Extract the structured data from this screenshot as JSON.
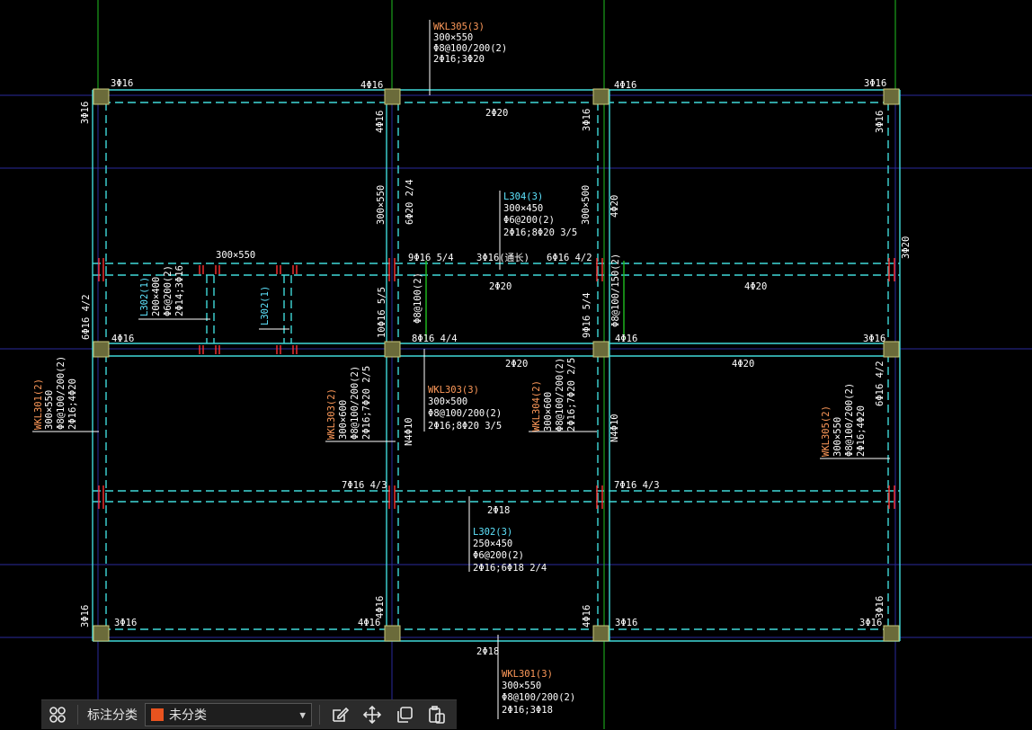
{
  "colors": {
    "background": "#000000",
    "grid_blue": "#2a2a9c",
    "grid_green": "#1fbf1f",
    "beam_cyan": "#40d9d9",
    "column_fill": "#6b6b3a",
    "label_white": "#ffffff",
    "label_orange": "#ff9a5a",
    "label_cyan": "#5ee5ff",
    "rebar_red": "#ff3030",
    "accent_orange": "#e8531f"
  },
  "labels": [
    {
      "id": "t1",
      "text": "WKL305(3)",
      "color": "label_orange"
    },
    {
      "id": "t2",
      "text": "300×550",
      "color": "label_white"
    },
    {
      "id": "t3",
      "text": "Φ8@100/200(2)",
      "color": "label_white"
    },
    {
      "id": "t4",
      "text": "2Φ16;3Φ20",
      "color": "label_white"
    },
    {
      "id": "t5",
      "text": "3Φ16",
      "color": "label_white"
    },
    {
      "id": "t6",
      "text": "4Φ16",
      "color": "label_white"
    },
    {
      "id": "t7",
      "text": "4Φ16",
      "color": "label_white"
    },
    {
      "id": "t8",
      "text": "3Φ16",
      "color": "label_white"
    },
    {
      "id": "t9",
      "text": "2Φ20",
      "color": "label_white"
    },
    {
      "id": "t10",
      "text": "3Φ16",
      "color": "label_white"
    },
    {
      "id": "t11",
      "text": "4Φ16",
      "color": "label_white"
    },
    {
      "id": "t12",
      "text": "3Φ16",
      "color": "label_white"
    },
    {
      "id": "t13",
      "text": "3Φ16",
      "color": "label_white"
    },
    {
      "id": "t14",
      "text": "L304(3)",
      "color": "label_cyan"
    },
    {
      "id": "t15",
      "text": "300×450",
      "color": "label_white"
    },
    {
      "id": "t16",
      "text": "Φ6@200(2)",
      "color": "label_white"
    },
    {
      "id": "t17",
      "text": "2Φ16;8Φ20 3/5",
      "color": "label_white"
    },
    {
      "id": "t18",
      "text": "300×550",
      "color": "label_white"
    },
    {
      "id": "t19",
      "text": "6Φ20 2/4",
      "color": "label_white"
    },
    {
      "id": "t20",
      "text": "300×500",
      "color": "label_white"
    },
    {
      "id": "t21",
      "text": "4Φ20",
      "color": "label_white"
    },
    {
      "id": "t22",
      "text": "3Φ20",
      "color": "label_white"
    },
    {
      "id": "t23",
      "text": "300×550",
      "color": "label_white"
    },
    {
      "id": "t24",
      "text": "9Φ16 5/4",
      "color": "label_white"
    },
    {
      "id": "t25",
      "text": "3Φ16(通长)",
      "color": "label_white"
    },
    {
      "id": "t26",
      "text": "6Φ16 4/2",
      "color": "label_white"
    },
    {
      "id": "t27",
      "text": "2Φ20",
      "color": "label_white"
    },
    {
      "id": "t28",
      "text": "4Φ20",
      "color": "label_white"
    },
    {
      "id": "t29",
      "text": "L302(1)",
      "color": "label_cyan"
    },
    {
      "id": "t30",
      "text": "200×400",
      "color": "label_white"
    },
    {
      "id": "t31",
      "text": "Φ6@200(2)",
      "color": "label_white"
    },
    {
      "id": "t32",
      "text": "2Φ14;3Φ16",
      "color": "label_white"
    },
    {
      "id": "t33",
      "text": "L302(1)",
      "color": "label_cyan"
    },
    {
      "id": "t34",
      "text": "10Φ16 5/5",
      "color": "label_white"
    },
    {
      "id": "t35",
      "text": "Φ8@100(2)",
      "color": "label_white"
    },
    {
      "id": "t36",
      "text": "9Φ16 5/4",
      "color": "label_white"
    },
    {
      "id": "t37",
      "text": "Φ8@100/150(2)",
      "color": "label_white"
    },
    {
      "id": "t38",
      "text": "6Φ16 4/2",
      "color": "label_white"
    },
    {
      "id": "t39",
      "text": "4Φ16",
      "color": "label_white"
    },
    {
      "id": "t40",
      "text": "8Φ16 4/4",
      "color": "label_white"
    },
    {
      "id": "t41",
      "text": "4Φ16",
      "color": "label_white"
    },
    {
      "id": "t42",
      "text": "3Φ16",
      "color": "label_white"
    },
    {
      "id": "t43",
      "text": "2Φ20",
      "color": "label_white"
    },
    {
      "id": "t44",
      "text": "4Φ20",
      "color": "label_white"
    },
    {
      "id": "t45",
      "text": "6Φ16 4/2",
      "color": "label_white"
    },
    {
      "id": "t46",
      "text": "WKL301(2)",
      "color": "label_orange"
    },
    {
      "id": "t47",
      "text": "300×550",
      "color": "label_white"
    },
    {
      "id": "t48",
      "text": "Φ8@100/200(2)",
      "color": "label_white"
    },
    {
      "id": "t49",
      "text": "2Φ16;4Φ20",
      "color": "label_white"
    },
    {
      "id": "t50",
      "text": "WKL303(2)",
      "color": "label_orange"
    },
    {
      "id": "t51",
      "text": "300×600",
      "color": "label_white"
    },
    {
      "id": "t52",
      "text": "Φ8@100/200(2)",
      "color": "label_white"
    },
    {
      "id": "t53",
      "text": "2Φ16;7Φ20 2/5",
      "color": "label_white"
    },
    {
      "id": "t54",
      "text": "WKL303(3)",
      "color": "label_orange"
    },
    {
      "id": "t55",
      "text": "300×500",
      "color": "label_white"
    },
    {
      "id": "t56",
      "text": "Φ8@100/200(2)",
      "color": "label_white"
    },
    {
      "id": "t57",
      "text": "2Φ16;8Φ20 3/5",
      "color": "label_white"
    },
    {
      "id": "t58",
      "text": "N4Φ10",
      "color": "label_white"
    },
    {
      "id": "t59",
      "text": "WKL304(2)",
      "color": "label_orange"
    },
    {
      "id": "t60",
      "text": "300×600",
      "color": "label_white"
    },
    {
      "id": "t61",
      "text": "Φ8@100/200(2)",
      "color": "label_white"
    },
    {
      "id": "t62",
      "text": "2Φ16;7Φ20 2/5",
      "color": "label_white"
    },
    {
      "id": "t63",
      "text": "N4Φ10",
      "color": "label_white"
    },
    {
      "id": "t64",
      "text": "WKL305(2)",
      "color": "label_orange"
    },
    {
      "id": "t65",
      "text": "300×550",
      "color": "label_white"
    },
    {
      "id": "t66",
      "text": "Φ8@100/200(2)",
      "color": "label_white"
    },
    {
      "id": "t67",
      "text": "2Φ16;4Φ20",
      "color": "label_white"
    },
    {
      "id": "t68",
      "text": "7Φ16 4/3",
      "color": "label_white"
    },
    {
      "id": "t69",
      "text": "7Φ16 4/3",
      "color": "label_white"
    },
    {
      "id": "t70",
      "text": "2Φ18",
      "color": "label_white"
    },
    {
      "id": "t71",
      "text": "L302(3)",
      "color": "label_cyan"
    },
    {
      "id": "t72",
      "text": "250×450",
      "color": "label_white"
    },
    {
      "id": "t73",
      "text": "Φ6@200(2)",
      "color": "label_white"
    },
    {
      "id": "t74",
      "text": "2Φ16;6Φ18 2/4",
      "color": "label_white"
    },
    {
      "id": "t75",
      "text": "3Φ16",
      "color": "label_white"
    },
    {
      "id": "t76",
      "text": "4Φ16",
      "color": "label_white"
    },
    {
      "id": "t77",
      "text": "4Φ16",
      "color": "label_white"
    },
    {
      "id": "t78",
      "text": "3Φ16",
      "color": "label_white"
    },
    {
      "id": "t79",
      "text": "3Φ16",
      "color": "label_white"
    },
    {
      "id": "t80",
      "text": "4Φ16",
      "color": "label_white"
    },
    {
      "id": "t81",
      "text": "3Φ16",
      "color": "label_white"
    },
    {
      "id": "t82",
      "text": "3Φ16",
      "color": "label_white"
    },
    {
      "id": "t83",
      "text": "2Φ18",
      "color": "label_white"
    },
    {
      "id": "t84",
      "text": "WKL301(3)",
      "color": "label_orange"
    },
    {
      "id": "t85",
      "text": "300×550",
      "color": "label_white"
    },
    {
      "id": "t86",
      "text": "Φ8@100/200(2)",
      "color": "label_white"
    },
    {
      "id": "t87",
      "text": "2Φ16;3Φ18",
      "color": "label_white"
    }
  ],
  "toolbar": {
    "grid_icon": "grid-four-icon",
    "category_label": "标注分类",
    "category_value": "未分类",
    "category_color": "#e8531f",
    "edit_icon": "edit-icon",
    "move_icon": "move-icon",
    "copy_icon": "copy-icon",
    "paste_icon": "paste-icon"
  }
}
